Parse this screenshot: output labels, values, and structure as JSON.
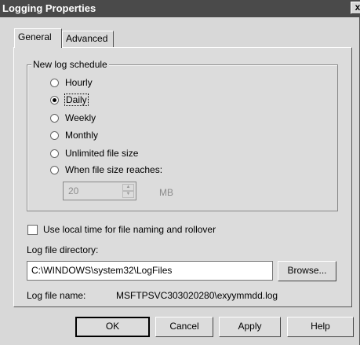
{
  "window": {
    "title": "Logging Properties",
    "close_glyph": "x"
  },
  "tabs": [
    {
      "label": "General"
    },
    {
      "label": "Advanced"
    }
  ],
  "schedule": {
    "group_title": "New log schedule",
    "options": [
      {
        "label": "Hourly",
        "checked": false
      },
      {
        "label": "Daily",
        "checked": true
      },
      {
        "label": "Weekly",
        "checked": false
      },
      {
        "label": "Monthly",
        "checked": false
      },
      {
        "label": "Unlimited file size",
        "checked": false
      },
      {
        "label": "When file size reaches:",
        "checked": false
      }
    ],
    "size_value": "20",
    "size_unit": "MB"
  },
  "local_time": {
    "label": "Use local time for file naming and rollover",
    "checked": false
  },
  "directory": {
    "label": "Log file directory:",
    "value": "C:\\WINDOWS\\system32\\LogFiles",
    "browse_label": "Browse..."
  },
  "file_name": {
    "label": "Log file name:",
    "value": "MSFTPSVC303020280\\exyymmdd.log"
  },
  "buttons": {
    "ok": "OK",
    "cancel": "Cancel",
    "apply": "Apply",
    "help": "Help"
  }
}
